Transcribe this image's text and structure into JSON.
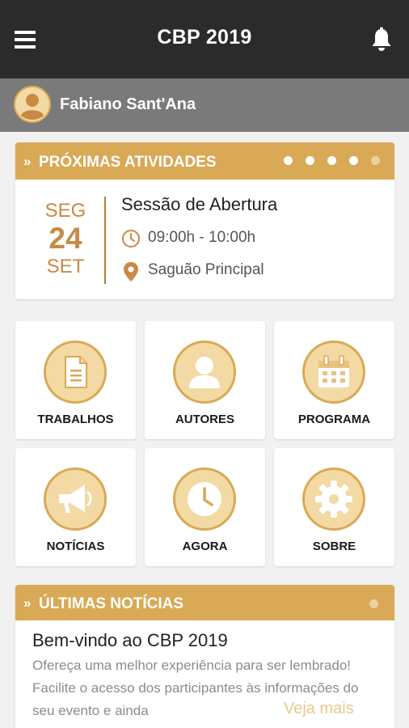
{
  "header": {
    "title": "CBP 2019",
    "menu_icon": "menu-icon",
    "bell_icon": "bell-icon"
  },
  "user": {
    "name": "Fabiano Sant'Ana"
  },
  "upcoming": {
    "heading": "PRÓXIMAS ATIVIDADES",
    "chevron": "»",
    "pager_total": 5,
    "pager_active": [
      0,
      1,
      2,
      3
    ],
    "event": {
      "weekday": "SEG",
      "day": "24",
      "month": "SET",
      "title": "Sessão de Abertura",
      "time": "09:00h - 10:00h",
      "location": "Saguão Principal"
    }
  },
  "tiles": [
    {
      "label": "TRABALHOS",
      "icon": "document-icon"
    },
    {
      "label": "AUTORES",
      "icon": "person-icon"
    },
    {
      "label": "PROGRAMA",
      "icon": "calendar-icon"
    },
    {
      "label": "NOTÍCIAS",
      "icon": "megaphone-icon"
    },
    {
      "label": "AGORA",
      "icon": "clock-icon"
    },
    {
      "label": "SOBRE",
      "icon": "gear-icon"
    }
  ],
  "news": {
    "heading": "ÚLTIMAS NOTÍCIAS",
    "chevron": "»",
    "title": "Bem-vindo ao CBP 2019",
    "body": "Ofereça uma melhor experiência para ser lembrado! Facilite o acesso dos participantes às informações do seu evento e ainda",
    "more": "Veja mais"
  },
  "colors": {
    "accent": "#d9a955",
    "accent_light": "#f3d9a3",
    "date": "#c88a45",
    "topbar": "#2b2b2b",
    "userbar": "#7a7a7a"
  }
}
